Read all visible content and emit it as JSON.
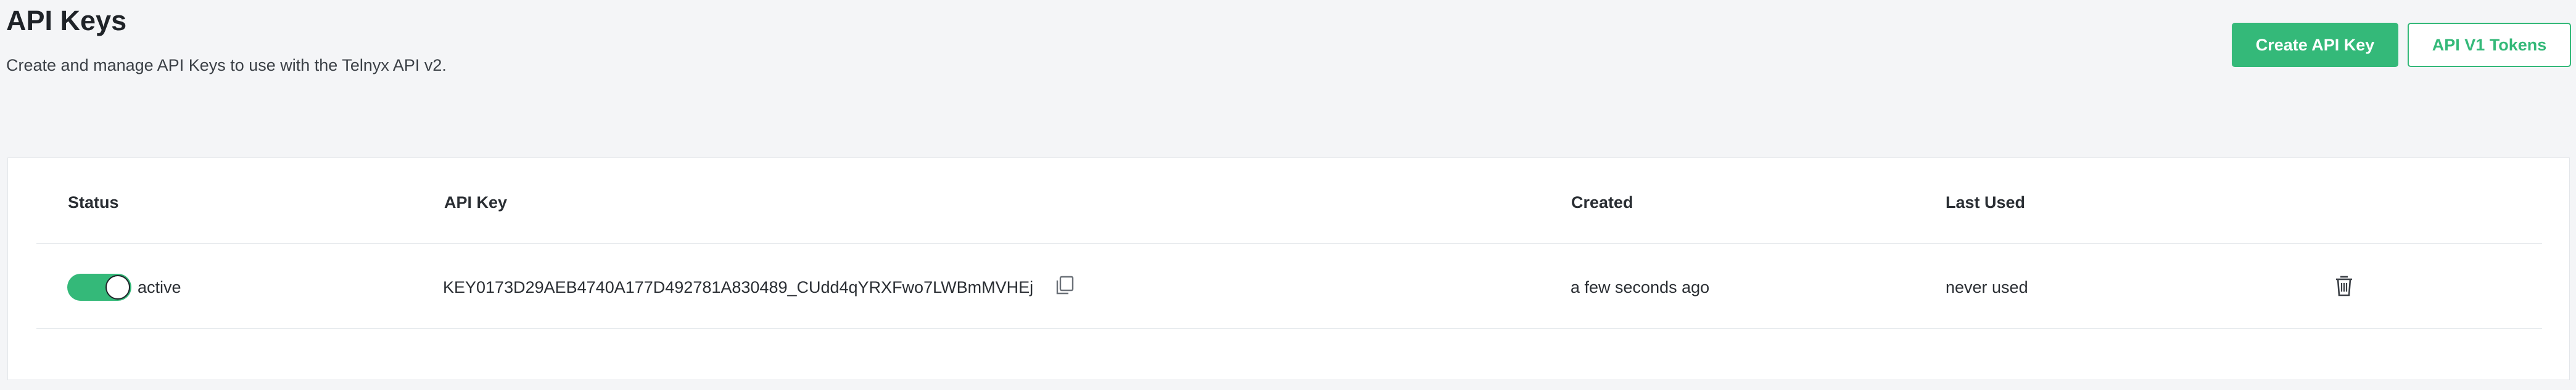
{
  "header": {
    "title": "API Keys",
    "subtitle": "Create and manage API Keys to use with the Telnyx API v2.",
    "create_button_label": "Create API Key",
    "v1_tokens_button_label": "API V1 Tokens"
  },
  "table": {
    "columns": [
      "Status",
      "API Key",
      "Created",
      "Last Used"
    ],
    "rows": [
      {
        "status": "active",
        "status_enabled": true,
        "api_key": "KEY0173D29AEB4740A177D492781A830489_CUdd4qYRXFwo7LWBmMVHEj",
        "created": "a few seconds ago",
        "last_used": "never used"
      }
    ]
  },
  "icons": {
    "copy": "copy-icon",
    "delete": "trash-icon"
  },
  "colors": {
    "accent": "#34b979",
    "background": "#f4f5f7",
    "card": "#ffffff"
  }
}
